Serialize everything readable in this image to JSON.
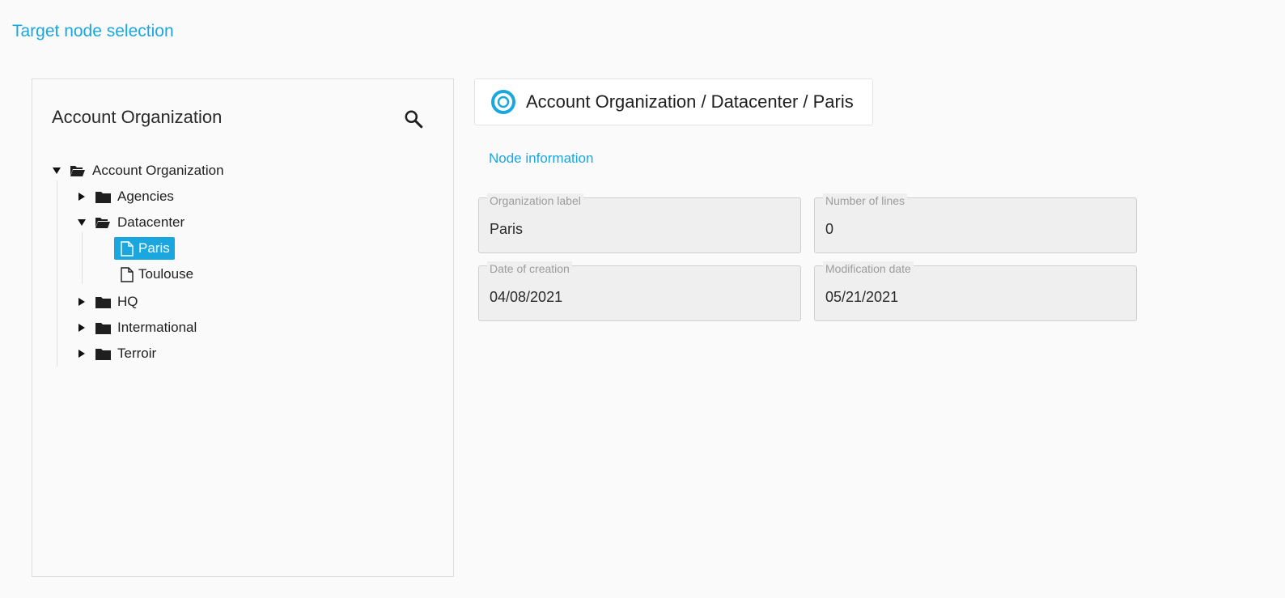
{
  "page": {
    "title": "Target node selection"
  },
  "tree_panel": {
    "title": "Account Organization",
    "search_icon": "search-icon",
    "root": {
      "label": "Account Organization",
      "children": [
        {
          "label": "Agencies"
        },
        {
          "label": "Datacenter",
          "children": [
            {
              "label": "Paris"
            },
            {
              "label": "Toulouse"
            }
          ]
        },
        {
          "label": "HQ"
        },
        {
          "label": "Intermational"
        },
        {
          "label": "Terroir"
        }
      ]
    }
  },
  "breadcrumb": {
    "icon": "target-icon",
    "path": "Account Organization / Datacenter / Paris"
  },
  "node_info": {
    "title": "Node information",
    "fields": {
      "organization_label": {
        "label": "Organization label",
        "value": "Paris"
      },
      "number_of_lines": {
        "label": "Number of lines",
        "value": "0"
      },
      "date_of_creation": {
        "label": "Date of creation",
        "value": "04/08/2021"
      },
      "modification_date": {
        "label": "Modification date",
        "value": "05/21/2021"
      }
    }
  },
  "colors": {
    "accent": "#1aa7e0",
    "selected_bg": "#1aa7e0",
    "field_bg": "#efefef"
  }
}
